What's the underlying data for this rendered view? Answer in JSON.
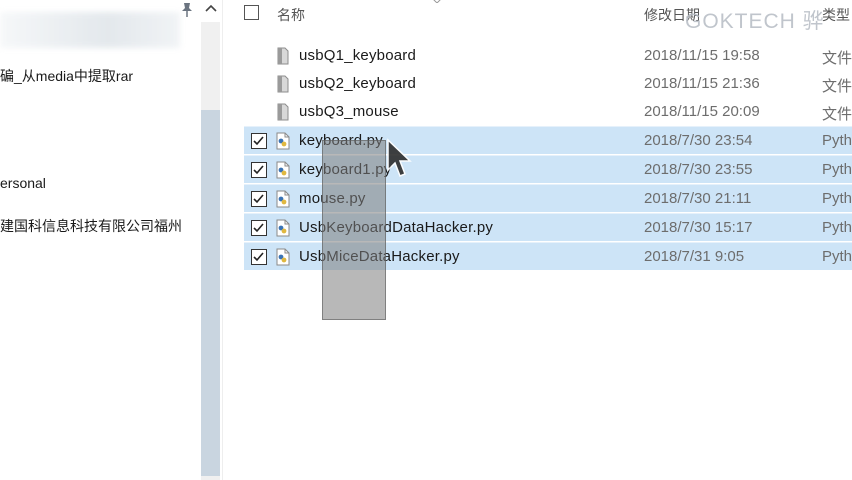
{
  "nav": {
    "items": [
      {
        "label": "碥_从media中提取rar"
      },
      {
        "label": "ersonal"
      },
      {
        "label": "建国科信息科技有限公司福州"
      }
    ]
  },
  "file_list": {
    "headers": {
      "name": "名称",
      "date": "修改日期",
      "type": "类型"
    },
    "watermark": "GOKTECH 骅",
    "rows": [
      {
        "name": "usbQ1_keyboard",
        "date": "2018/11/15 19:58",
        "type": "文件",
        "selected": false,
        "icon": "document-icon"
      },
      {
        "name": "usbQ2_keyboard",
        "date": "2018/11/15 21:36",
        "type": "文件",
        "selected": false,
        "icon": "document-icon"
      },
      {
        "name": "usbQ3_mouse",
        "date": "2018/11/15 20:09",
        "type": "文件",
        "selected": false,
        "icon": "document-icon"
      },
      {
        "name": "keyboard.py",
        "date": "2018/7/30 23:54",
        "type": "Pyth",
        "selected": true,
        "icon": "python-file-icon"
      },
      {
        "name": "keyboard1.py",
        "date": "2018/7/30 23:55",
        "type": "Pyth",
        "selected": true,
        "icon": "python-file-icon"
      },
      {
        "name": "mouse.py",
        "date": "2018/7/30 21:11",
        "type": "Pyth",
        "selected": true,
        "icon": "python-file-icon"
      },
      {
        "name": "UsbKeyboardDataHacker.py",
        "date": "2018/7/30 15:17",
        "type": "Pyth",
        "selected": true,
        "icon": "python-file-icon"
      },
      {
        "name": "UsbMiceDataHacker.py",
        "date": "2018/7/31 9:05",
        "type": "Pyth",
        "selected": true,
        "icon": "python-file-icon"
      }
    ]
  },
  "colors": {
    "selection": "#cde4f7",
    "scroll_thumb": "#c9d5e0",
    "drag_ghost": "#7d7d7d"
  }
}
